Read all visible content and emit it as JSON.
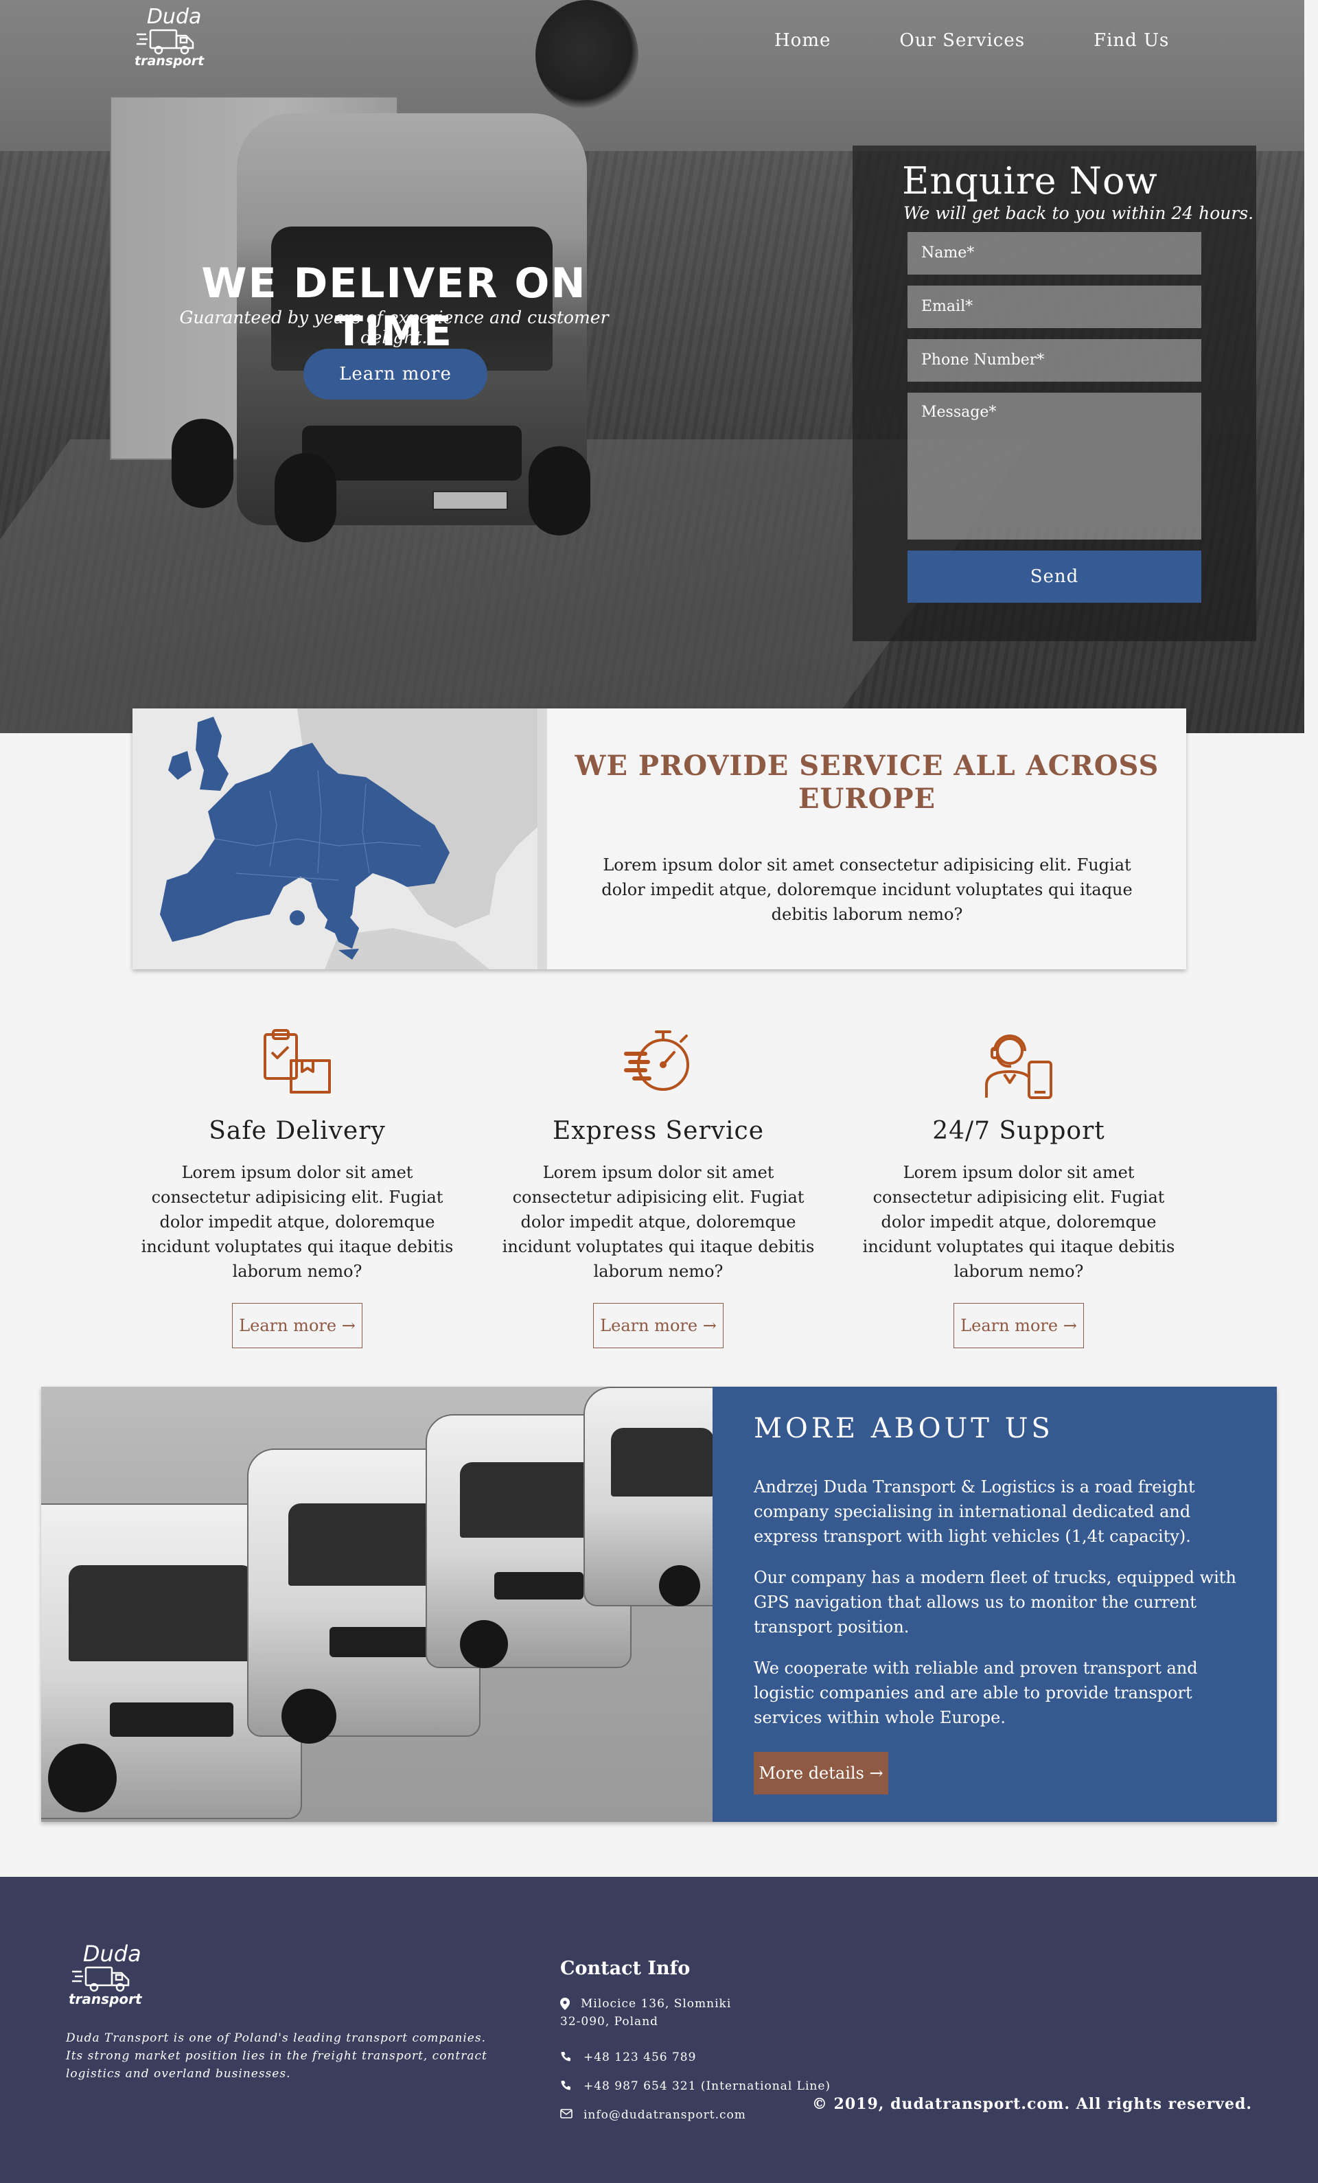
{
  "brand": {
    "name": "Duda",
    "sub": "transport"
  },
  "nav": {
    "items": [
      "Home",
      "Our Services",
      "Find Us"
    ]
  },
  "hero": {
    "title": "WE DELIVER ON TIME",
    "subtitle": "Guaranteed by years of experience and customer delight.",
    "cta": "Learn more"
  },
  "enquire": {
    "title": "Enquire Now",
    "subtitle": "We will get back to you within 24 hours.",
    "name_placeholder": "Name*",
    "email_placeholder": "Email*",
    "phone_placeholder": "Phone Number*",
    "message_placeholder": "Message*",
    "send": "Send"
  },
  "europe": {
    "title": "WE PROVIDE SERVICE ALL ACROSS EUROPE",
    "text": "Lorem ipsum dolor sit amet consectetur adipisicing elit. Fugiat dolor impedit atque, doloremque incidunt voluptates qui itaque debitis laborum nemo?"
  },
  "services": [
    {
      "title": "Safe Delivery",
      "icon": "clipboard-box-icon",
      "text": "Lorem ipsum dolor sit amet consectetur adipisicing elit. Fugiat dolor impedit atque, doloremque incidunt voluptates qui itaque debitis laborum nemo?",
      "link": "Learn more →"
    },
    {
      "title": "Express Service",
      "icon": "stopwatch-icon",
      "text": "Lorem ipsum dolor sit amet consectetur adipisicing elit. Fugiat dolor impedit atque, doloremque incidunt voluptates qui itaque debitis laborum nemo?",
      "link": "Learn more →"
    },
    {
      "title": "24/7 Support",
      "icon": "support-agent-icon",
      "text": "Lorem ipsum dolor sit amet consectetur adipisicing elit. Fugiat dolor impedit atque, doloremque incidunt voluptates qui itaque debitis laborum nemo?",
      "link": "Learn more →"
    }
  ],
  "about": {
    "title": "MORE ABOUT US",
    "paragraphs": [
      "Andrzej Duda Transport & Logistics is a road freight company specialising in international dedicated and express transport with light vehicles (1,4t capacity).",
      "Our company has a modern fleet of trucks, equipped with GPS navigation that allows us to monitor the current transport position.",
      "We cooperate with reliable and proven transport and logistic companies and are able to provide transport services within whole Europe."
    ],
    "button": "More details →"
  },
  "footer": {
    "description": "Duda Transport is one of Poland's leading transport companies. Its strong market position lies in the freight transport, contract logistics and overland businesses.",
    "contact_title": "Contact Info",
    "address_line1": "Milocice 136, Slomniki",
    "address_line2": "32-090, Poland",
    "phone": "+48 123 456 789",
    "phone_international": "+48 987 654 321 (International Line)",
    "email": "info@dudatransport.com",
    "copyright": "© 2019, dudatransport.com. All rights reserved."
  },
  "colors": {
    "primary_blue": "#365a94",
    "accent_brown": "#8e5a44",
    "footer_bg": "#3a3d5c",
    "about_bg": "#365a8f"
  }
}
